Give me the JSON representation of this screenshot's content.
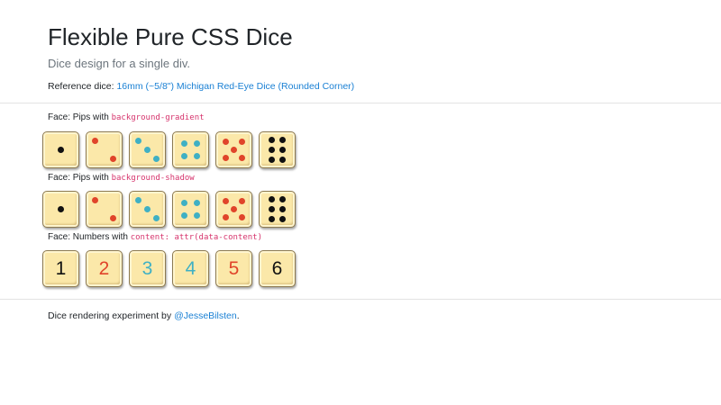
{
  "header": {
    "title": "Flexible Pure CSS Dice",
    "subtitle": "Dice design for a single div."
  },
  "reference": {
    "label": "Reference dice: ",
    "link_text": "16mm (~5/8\") Michigan Red-Eye Dice (Rounded Corner)"
  },
  "sections": [
    {
      "prefix": "Face: Pips with ",
      "code": "background-gradient"
    },
    {
      "prefix": "Face: Pips with ",
      "code": "background-shadow"
    },
    {
      "prefix": "Face: Numbers with ",
      "code": "content: attr(data-content)"
    }
  ],
  "dice": {
    "numbers": [
      "1",
      "2",
      "3",
      "4",
      "5",
      "6"
    ],
    "pip_colors": {
      "one": "#111111",
      "two": "#e0442a",
      "three": "#3fb0c4",
      "four": "#3fb0c4",
      "five": "#e0442a",
      "six": "#111111"
    },
    "face_color": "#fbe8a9"
  },
  "footer": {
    "text": "Dice rendering experiment by ",
    "link_text": "@JesseBilsten",
    "suffix": "."
  }
}
